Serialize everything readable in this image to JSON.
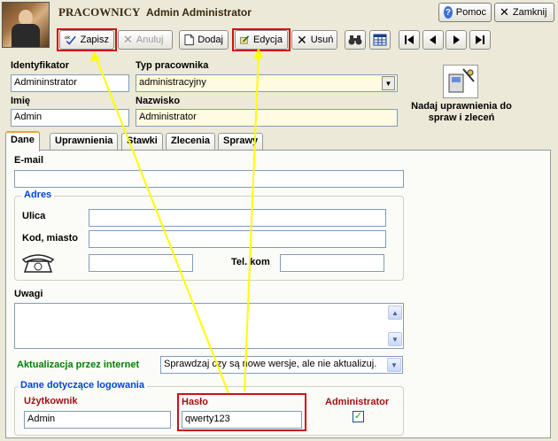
{
  "header": {
    "title": "PRACOWNICY",
    "user": "Admin  Administrator",
    "help_label": "Pomoc",
    "close_label": "Zamknij"
  },
  "toolbar": {
    "save_label": "Zapisz",
    "cancel_label": "Anuluj",
    "add_label": "Dodaj",
    "edit_label": "Edycja",
    "delete_label": "Usuń"
  },
  "form": {
    "identifier": {
      "label": "Identyfikator",
      "value": "Admininstrator"
    },
    "employee_type": {
      "label": "Typ pracownika",
      "value": "administracyjny"
    },
    "first_name": {
      "label": "Imię",
      "value": "Admin"
    },
    "last_name": {
      "label": "Nazwisko",
      "value": "Administrator"
    },
    "permissions_button": "Nadaj uprawnienia do spraw i zleceń"
  },
  "tabs": [
    {
      "label": "Dane"
    },
    {
      "label": "Uprawnienia"
    },
    {
      "label": "Stawki"
    },
    {
      "label": "Zlecenia"
    },
    {
      "label": "Sprawy"
    }
  ],
  "data_tab": {
    "email_label": "E-mail",
    "email_value": "",
    "address_group": "Adres",
    "street_label": "Ulica",
    "street_value": "",
    "zip_city_label": "Kod, miasto",
    "zip_city_value": "",
    "phone_value": "",
    "mobile_label": "Tel. kom",
    "mobile_value": "",
    "notes_label": "Uwagi",
    "notes_value": "",
    "update_label": "Aktualizacja przez internet",
    "update_value": "Sprawdzaj czy są nowe wersje, ale nie aktualizuj.",
    "login_group": "Dane dotyczące logowania",
    "username_label": "Użytkownik",
    "username_value": "Admin",
    "password_label": "Hasło",
    "password_value": "qwerty123",
    "admin_label": "Administrator",
    "admin_checked": true
  },
  "colors": {
    "background": "#ece9d8",
    "highlight": "#cc1111",
    "arrow": "#ffff00",
    "group_title": "#0046d5",
    "update_label": "#008000",
    "login_labels": "#9b1010"
  }
}
